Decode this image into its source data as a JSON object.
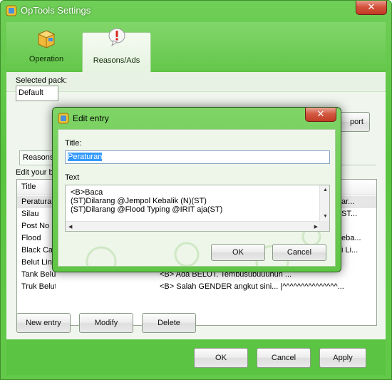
{
  "window": {
    "title": "OpTools Settings",
    "close_glyph": "✕"
  },
  "ribbon": {
    "tabs": [
      {
        "label": "Operation",
        "icon": "package-icon"
      },
      {
        "label": "Reasons/Ads",
        "icon": "exclamation-bubble-icon"
      }
    ]
  },
  "settings": {
    "selected_pack_label": "Selected pack:",
    "selected_pack_value": "Default",
    "import_label": "port",
    "reasons_tab": "Reasons",
    "edit_label": "Edit your b"
  },
  "list": {
    "header_title": "Title",
    "rows": [
      {
        "title": "Peraturan",
        "text": "ar..."
      },
      {
        "title": "Silau",
        "text": "ST..."
      },
      {
        "title": "Post No",
        "text": ""
      },
      {
        "title": "Flood",
        "text": "eba..."
      },
      {
        "title": "Black Can",
        "text": "i Li..."
      },
      {
        "title": "Belut Lind",
        "text": ""
      },
      {
        "title": "Tank Belut",
        "text": "<B> Ada BELUT. Tembusubuuuhuh ..."
      },
      {
        "title": "Truk Belut",
        "text": "<B> Salah GENDER angkut sini... |^^^^^^^^^^^^^^^..."
      }
    ]
  },
  "list_buttons": {
    "new": "New entry",
    "modify": "Modify",
    "delete": "Delete"
  },
  "footer": {
    "ok": "OK",
    "cancel": "Cancel",
    "apply": "Apply"
  },
  "dialog": {
    "title": "Edit entry",
    "close_glyph": "✕",
    "title_label": "Title:",
    "title_value": "Peraturan",
    "text_label": "Text",
    "text_value": "<B>Baca\n(ST)Dilarang @Jempol Kebalik (N)(ST)\n(ST)Dilarang @Flood Typing @IRIT aja(ST)",
    "ok": "OK",
    "cancel": "Cancel"
  },
  "colors": {
    "accent_green": "#5cc443",
    "selection_blue": "#3399ff",
    "close_red": "#c23a22"
  }
}
